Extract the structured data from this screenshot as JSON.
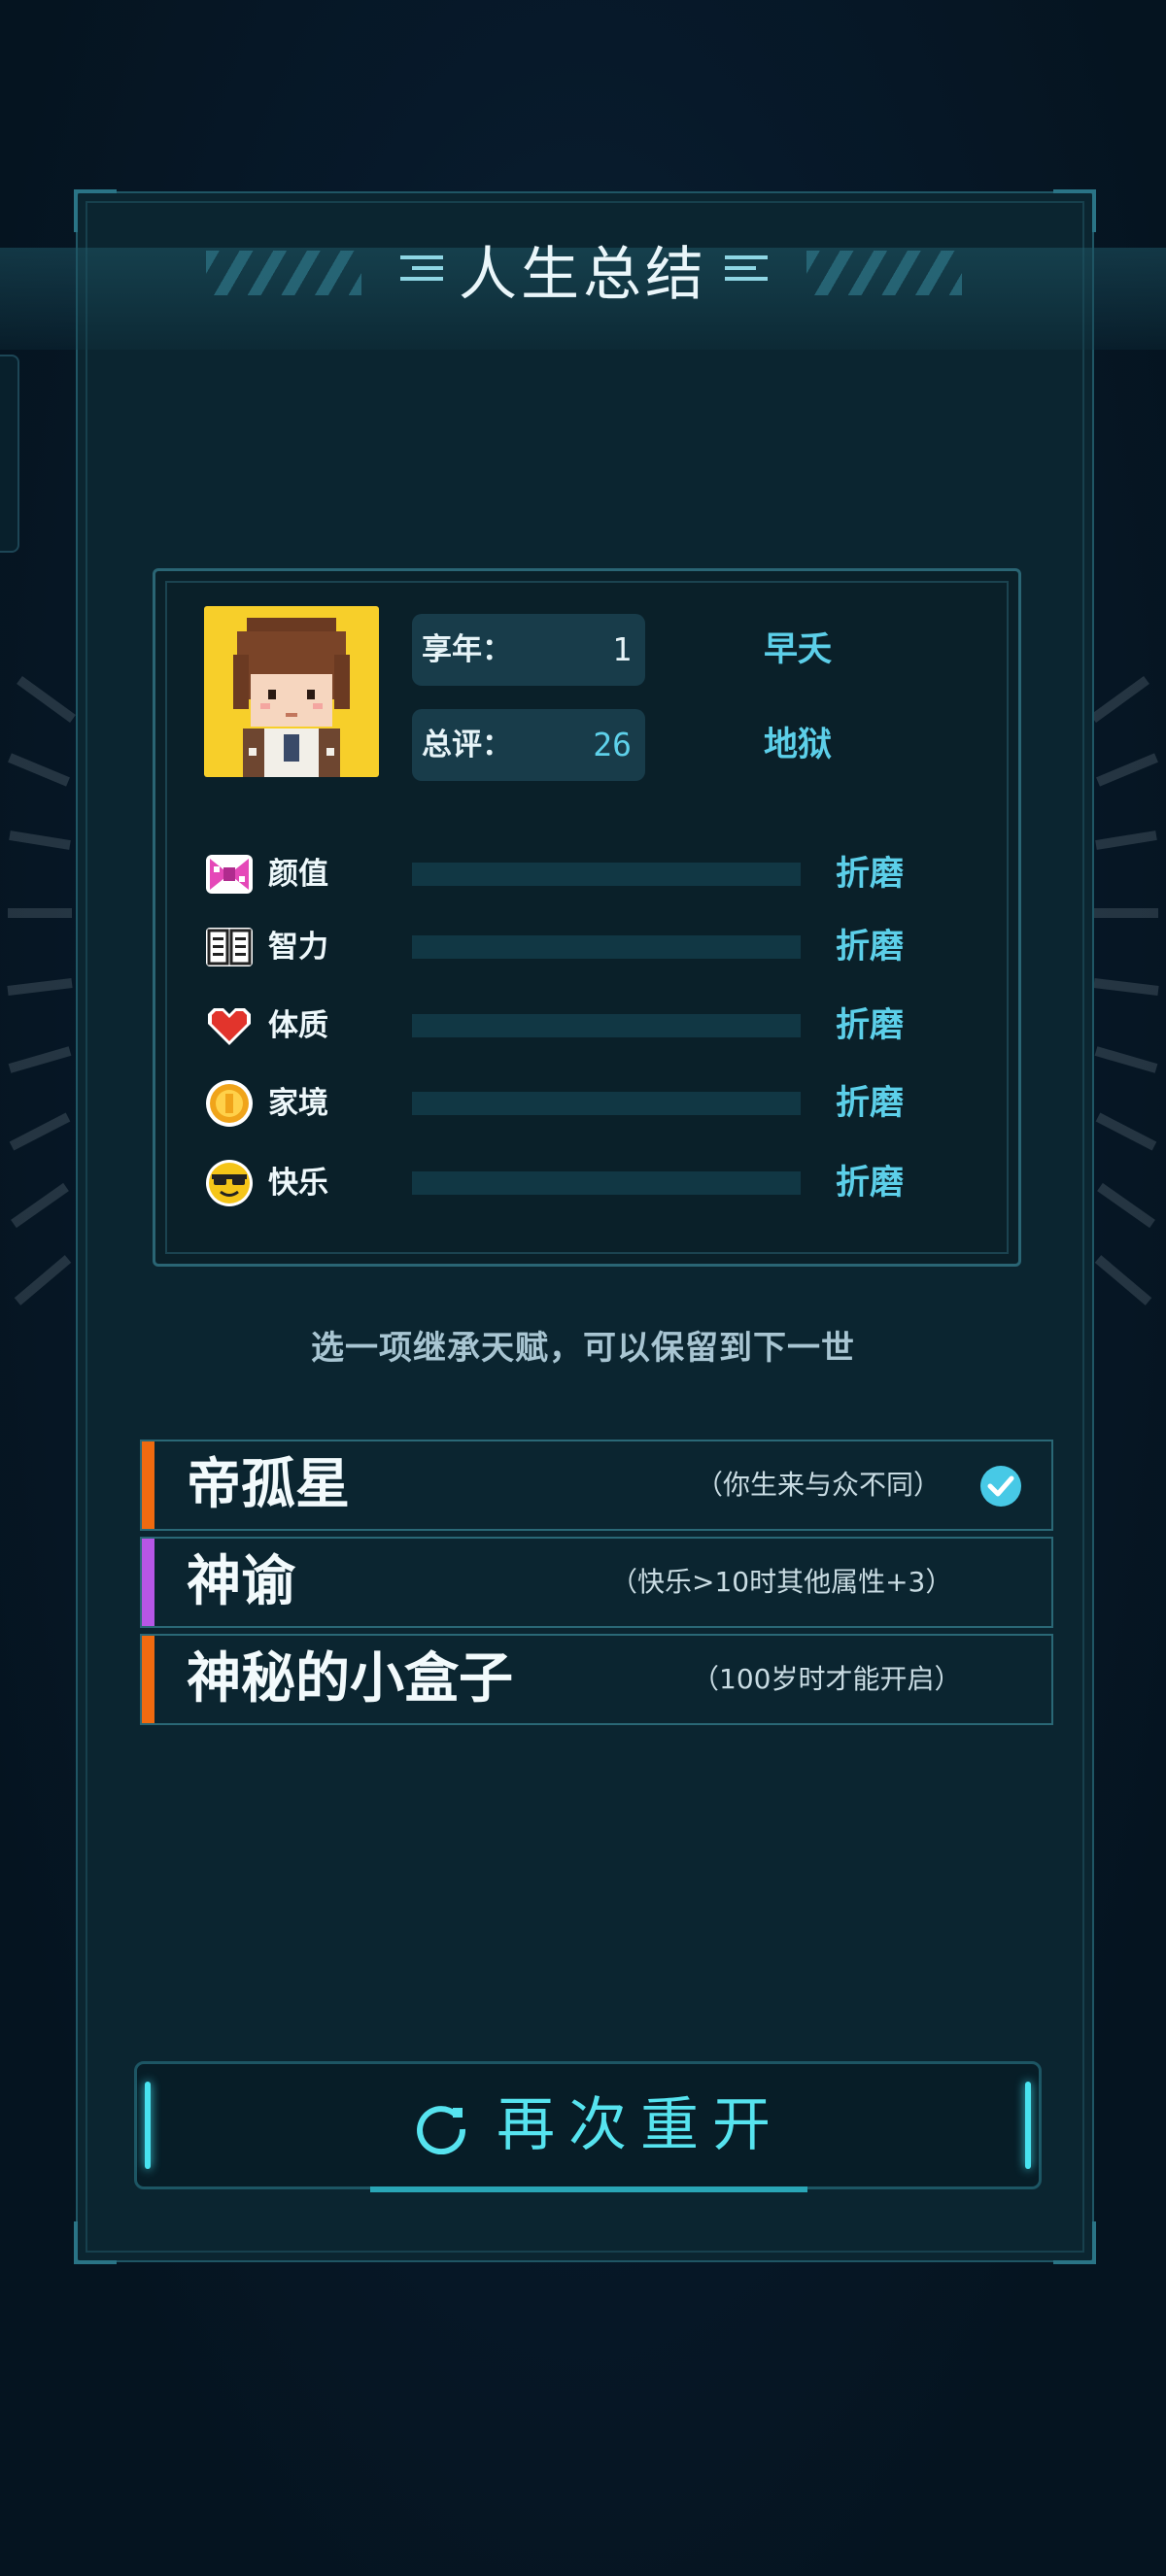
{
  "title": "人生总结",
  "summary": {
    "age_label": "享年：",
    "age_value": "1",
    "age_desc": "早夭",
    "score_label": "总评：",
    "score_value": "26",
    "score_desc": "地狱"
  },
  "attributes": [
    {
      "icon": "bow-icon",
      "label": "颜值",
      "value": "折磨",
      "level": 0
    },
    {
      "icon": "book-icon",
      "label": "智力",
      "value": "折磨",
      "level": 0
    },
    {
      "icon": "heart-icon",
      "label": "体质",
      "value": "折磨",
      "level": 0
    },
    {
      "icon": "coin-icon",
      "label": "家境",
      "value": "折磨",
      "level": 0
    },
    {
      "icon": "sunglasses-face-icon",
      "label": "快乐",
      "value": "折磨",
      "level": 0
    }
  ],
  "hint": "选一项继承天赋，可以保留到下一世",
  "talents": [
    {
      "name": "帝孤星",
      "desc": "（你生来与众不同）",
      "accent": "#f06a0f",
      "selected": true
    },
    {
      "name": "神谕",
      "desc": "（快乐>10时其他属性+3）",
      "accent": "#b656e6",
      "selected": false
    },
    {
      "name": "神秘的小盒子",
      "desc": "（100岁时才能开启）",
      "accent": "#f06a0f",
      "selected": false
    }
  ],
  "restart_label": "再次重开",
  "colors": {
    "accent_cyan": "#5ccfe9",
    "avatar_bg": "#f7cf2a",
    "orange": "#f06a0f",
    "purple": "#b656e6"
  }
}
